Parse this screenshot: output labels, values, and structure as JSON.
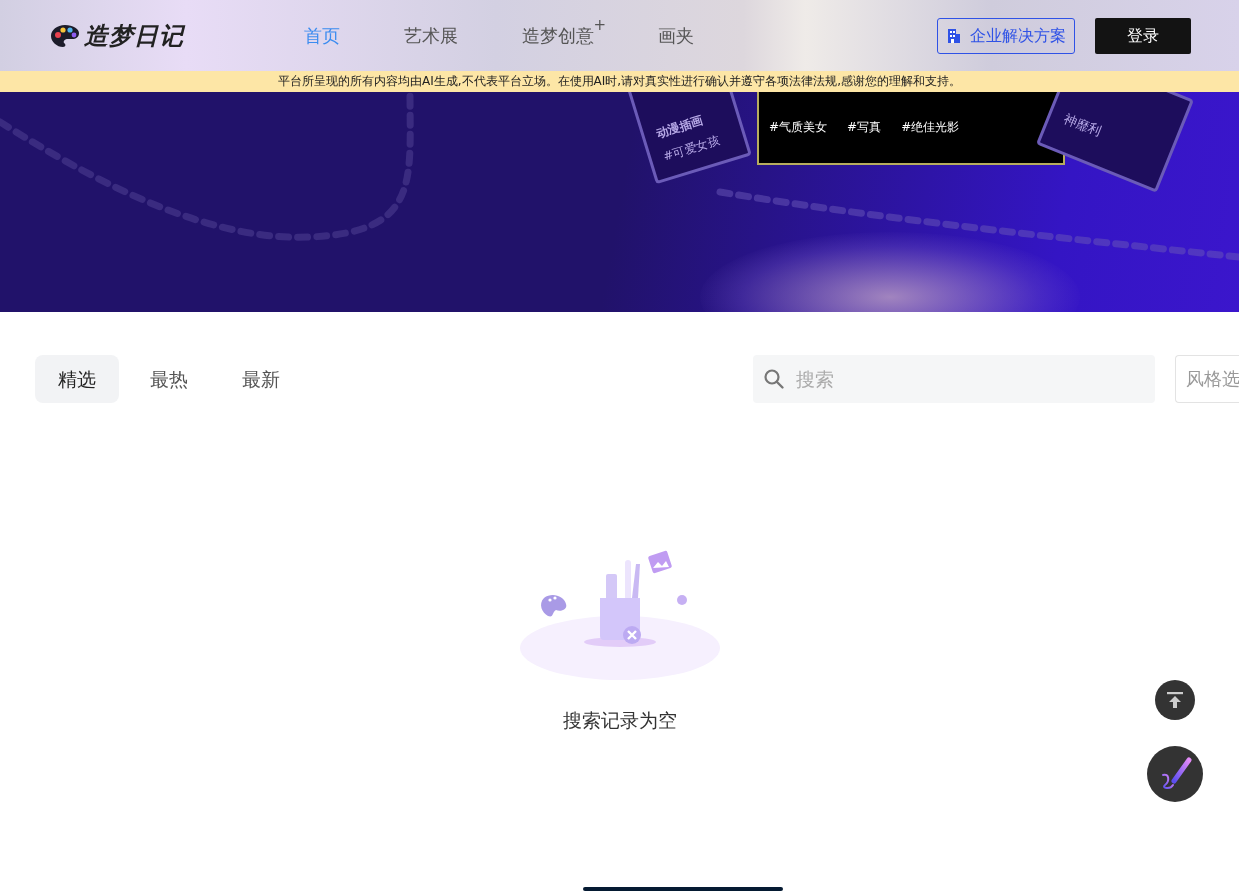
{
  "header": {
    "logo": "造梦日记",
    "nav": [
      {
        "label": "首页",
        "selected": true
      },
      {
        "label": "艺术展",
        "selected": false
      },
      {
        "label": "造梦创意",
        "selected": false,
        "superscript": "+"
      },
      {
        "label": "画夹",
        "selected": false
      }
    ],
    "enterprise_button": "企业解决方案",
    "login_button": "登录"
  },
  "notice": "平台所呈现的所有内容均由AI生成,不代表平台立场。在使用AI时,请对真实性进行确认并遵守各项法律法规,感谢您的理解和支持。",
  "banner": {
    "cards": [
      {
        "kind": "left",
        "title": "动漫插画",
        "tags": [
          "#可爱女孩"
        ]
      },
      {
        "kind": "center",
        "tags": [
          "#气质美女",
          "#写真",
          "#绝佳光影"
        ]
      },
      {
        "kind": "right",
        "tags": [
          "神靡利"
        ]
      }
    ]
  },
  "filters": {
    "tabs": [
      {
        "label": "精选",
        "selected": true
      },
      {
        "label": "最热",
        "selected": false
      },
      {
        "label": "最新",
        "selected": false
      }
    ],
    "search": {
      "placeholder": "搜索"
    },
    "style_select": "风格选"
  },
  "empty_state": {
    "message": "搜索记录为空"
  }
}
